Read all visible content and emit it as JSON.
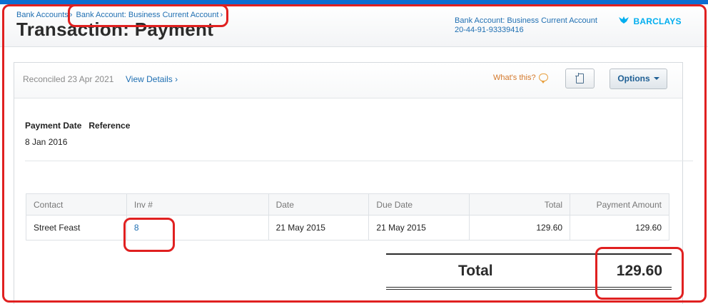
{
  "breadcrumb": {
    "items": [
      "Bank Accounts",
      "Bank Account: Business Current Account"
    ],
    "separator": "›"
  },
  "page": {
    "title": "Transaction: Payment"
  },
  "account": {
    "name": "Bank Account: Business Current Account",
    "number": "20-44-91-93339416",
    "bank": "BARCLAYS"
  },
  "status_bar": {
    "reconciled": "Reconciled 23 Apr 2021",
    "view_details": "View Details ›",
    "whats_this": "What's this?",
    "options_label": "Options"
  },
  "details": {
    "payment_date_label": "Payment Date",
    "reference_label": "Reference",
    "payment_date_value": "8 Jan 2016"
  },
  "table": {
    "headers": [
      "Contact",
      "Inv #",
      "Date",
      "Due Date",
      "Total",
      "Payment Amount"
    ],
    "rows": [
      {
        "contact": "Street Feast",
        "inv": "8",
        "date": "21 May 2015",
        "due_date": "21 May 2015",
        "total": "129.60",
        "payment_amount": "129.60"
      }
    ]
  },
  "totals": {
    "label": "Total",
    "value": "129.60"
  },
  "colors": {
    "accent": "#1f6fb2",
    "brand": "#00aeef",
    "annotation": "#e02020"
  }
}
